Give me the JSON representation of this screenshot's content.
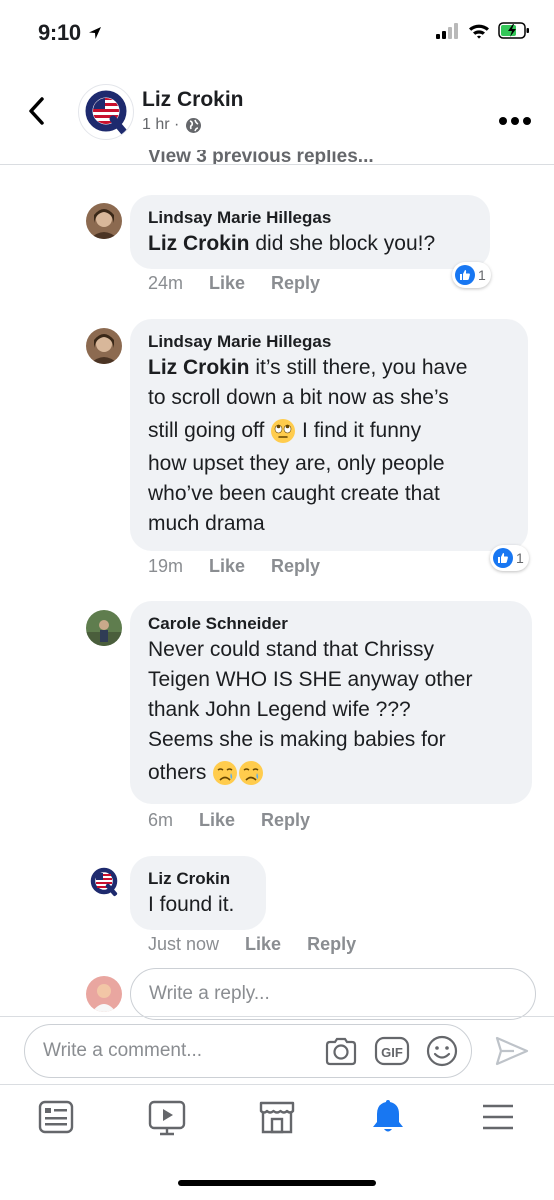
{
  "status_bar": {
    "time": "9:10"
  },
  "header": {
    "page_name": "Liz Crokin",
    "timestamp": "1 hr ·"
  },
  "thread": {
    "previous_replies_label": "View 3 previous replies..."
  },
  "comments": [
    {
      "author": "Lindsay Marie Hillegas",
      "mention": "Liz Crokin",
      "text_1": " did she block you!?",
      "time": "24m",
      "like_label": "Like",
      "reply_label": "Reply",
      "reactions": "1"
    },
    {
      "author": "Lindsay Marie Hillegas",
      "mention": "Liz Crokin",
      "line_1": " it’s still there, you have",
      "line_2": "to scroll down a bit now as she’s",
      "line_3a": "still going off ",
      "emoji_1": "face-with-rolling-eyes",
      "line_3b": " I find it funny",
      "line_4": "how upset they are, only people",
      "line_5": "who’ve been caught create that",
      "line_6": "much drama",
      "time": "19m",
      "like_label": "Like",
      "reply_label": "Reply",
      "reactions": "1"
    },
    {
      "author": "Carole Schneider",
      "line_1": "Never could stand that Chrissy",
      "line_2": "Teigen  WHO IS SHE anyway other",
      "line_3": "thank John Legend wife ???",
      "line_4": "Seems she is making babies for",
      "line_5": "others ",
      "emoji": "crying-face",
      "time": "6m",
      "like_label": "Like",
      "reply_label": "Reply"
    },
    {
      "author": "Liz Crokin",
      "text": "I found it.",
      "time": "Just now",
      "like_label": "Like",
      "reply_label": "Reply"
    }
  ],
  "reply_box": {
    "placeholder": "Write a reply..."
  },
  "comment_bar": {
    "placeholder": "Write a comment..."
  },
  "tab_bar": {
    "items": [
      "news-feed",
      "watch",
      "marketplace",
      "notifications",
      "menu"
    ],
    "active": "notifications"
  },
  "colors": {
    "accent": "#1877f2",
    "bubble": "#f0f2f5",
    "meta_text": "#8a8d91"
  }
}
